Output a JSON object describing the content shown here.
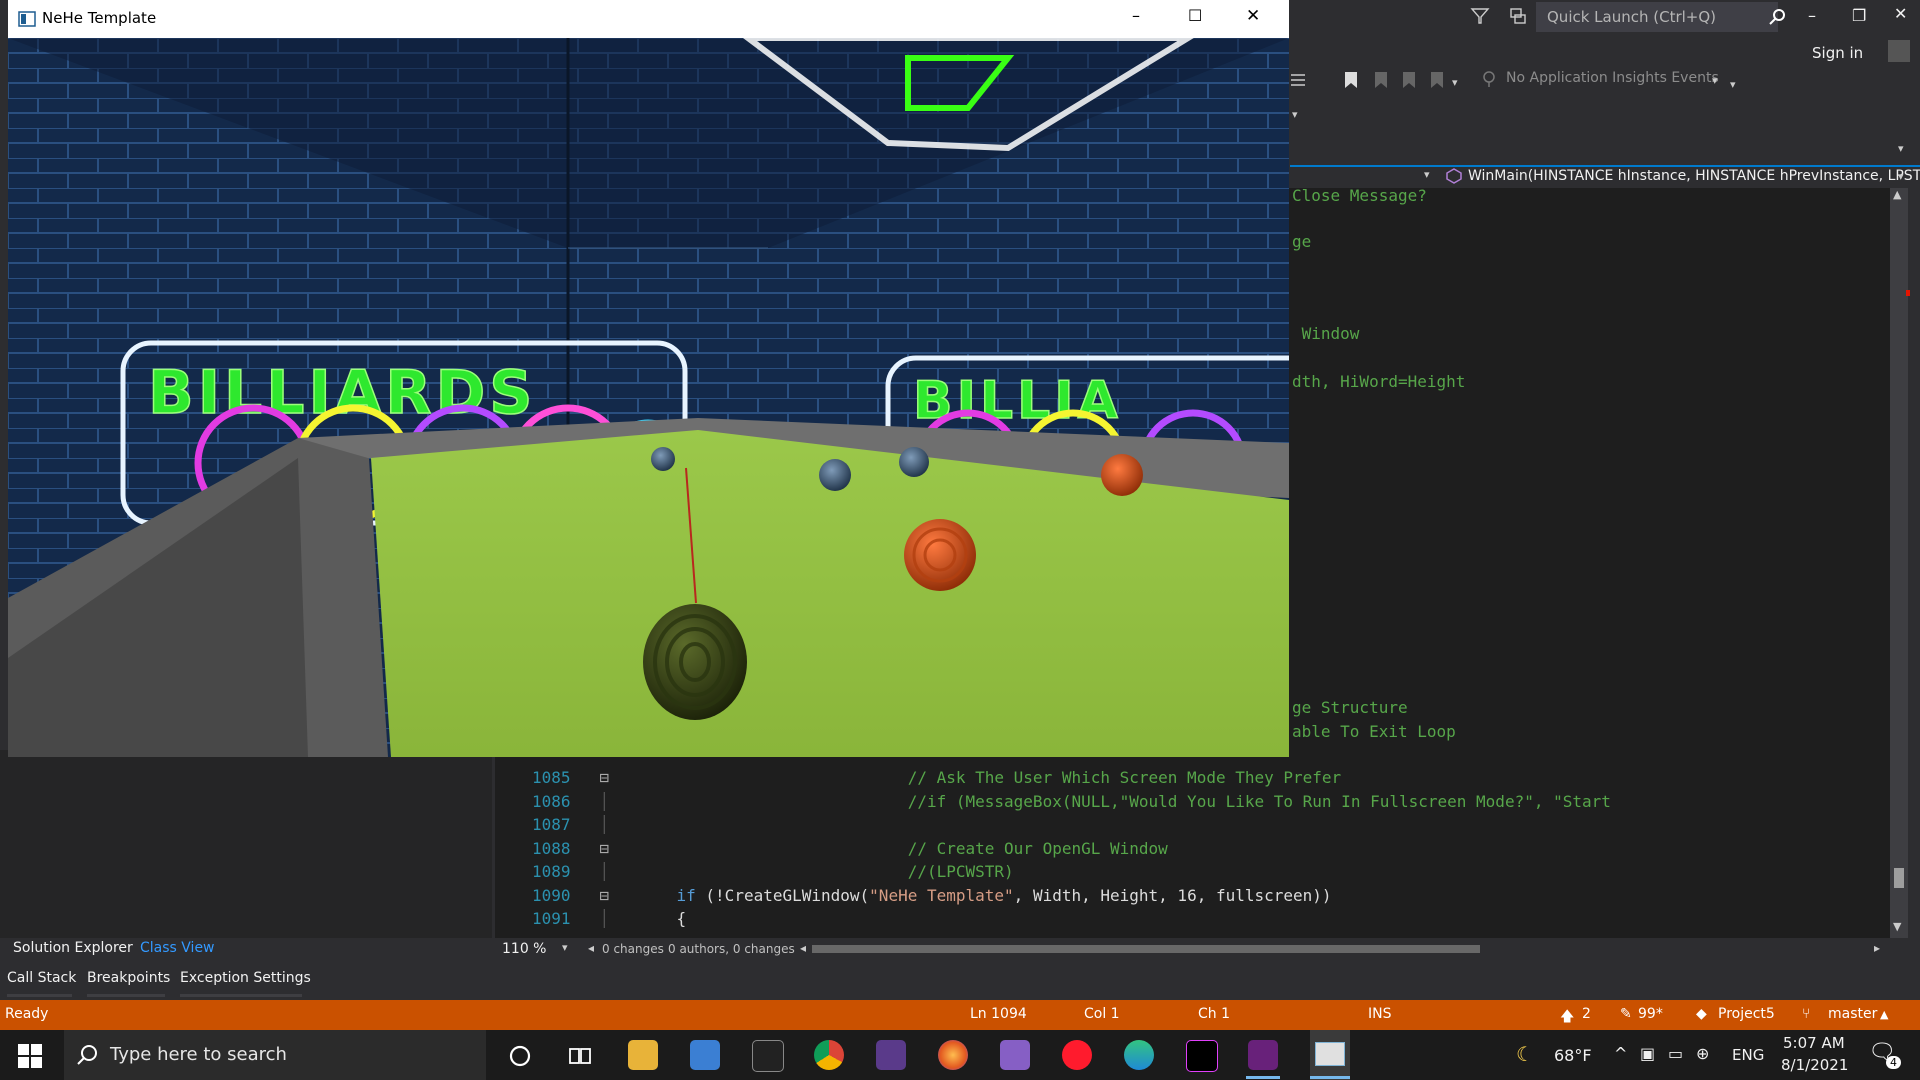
{
  "vs": {
    "quick_launch_placeholder": "Quick Launch (Ctrl+Q)",
    "sign_in": "Sign in",
    "ai_events": "No Application Insights Events",
    "nav_function": "WinMain(HINSTANCE hInstance, HINSTANCE hPrevInstance, LPST",
    "partial_lines": [
      {
        "text": "Close Message?"
      },
      {
        "text": "ge"
      },
      {
        "text": " Window"
      },
      {
        "text": "dth, HiWord=Height"
      },
      {
        "text": "ge Structure"
      },
      {
        "text": "able To Exit Loop"
      }
    ],
    "code_lines": [
      {
        "num": "1085",
        "text": "                            // Ask The User Which Screen Mode They Prefer",
        "type": "cmt"
      },
      {
        "num": "1086",
        "text": "                            //if (MessageBox(NULL,\"Would You Like To Run In Fullscreen Mode?\", \"Start",
        "type": "cmt"
      },
      {
        "num": "1087",
        "text": "",
        "type": "plain"
      },
      {
        "num": "1088",
        "text": "                            // Create Our OpenGL Window",
        "type": "cmt"
      },
      {
        "num": "1089",
        "text": "                            //(LPCWSTR)",
        "type": "cmt"
      },
      {
        "num": "1090",
        "kw": "if",
        "rest1": " (!CreateGLWindow(",
        "str": "\"NeHe Template\"",
        "rest2": ", Width, Height, 16, fullscreen))",
        "type": "mixed"
      },
      {
        "num": "1091",
        "text": "{",
        "type": "plain"
      }
    ],
    "zoom": "110 %",
    "changes": "0 changes",
    "authors": "0 authors, 0 changes",
    "panel_tabs": [
      "Solution Explorer",
      "Class View"
    ],
    "bottom_tabs": [
      "Call Stack",
      "Breakpoints",
      "Exception Settings"
    ],
    "status": {
      "ready": "Ready",
      "ln": "Ln 1094",
      "col": "Col 1",
      "ch": "Ch 1",
      "ins": "INS",
      "up_count": "2",
      "edits": "99*",
      "project": "Project5",
      "branch": "master"
    }
  },
  "gl_window": {
    "title": "NeHe Template",
    "sign_left": "BILLIARDS",
    "sign_right": "BILLIA"
  },
  "taskbar": {
    "search_placeholder": "Type here to search",
    "weather": "68°F",
    "language": "ENG",
    "time": "5:07 AM",
    "date": "8/1/2021",
    "notifications": "4"
  },
  "colors": {
    "status_bar": "#ca5100",
    "accent": "#007acc",
    "felt": "#8fbd3a"
  }
}
